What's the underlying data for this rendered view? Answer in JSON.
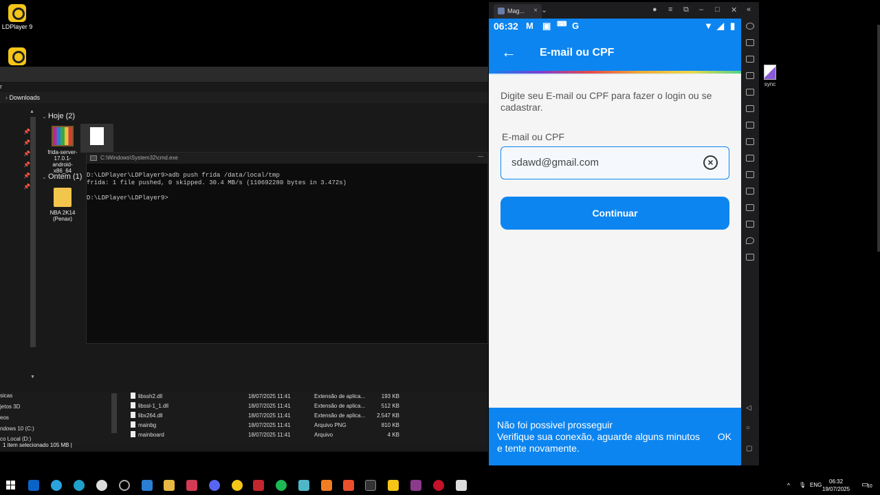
{
  "desktop": {
    "ldplayer_icon_label": "LDPlayer 9",
    "sync_label": "sync"
  },
  "explorer": {
    "breadcrumb": "Downloads",
    "groups": [
      {
        "label": "Hoje (2)"
      },
      {
        "label": "Ontem (1)"
      }
    ],
    "files": [
      {
        "name": "frida-server-17.0.1-android-x86_64",
        "icon": "winrar-icon"
      },
      {
        "name": "NBA 2K14 (Penax)",
        "icon": "folder-icon"
      }
    ],
    "nav_items": [
      "sicas",
      "jetos 3D",
      "eos",
      "ndows 10 (C:)",
      "co Local (D:)"
    ],
    "detail_rows": [
      {
        "name": "libssh2.dll",
        "date": "18/07/2025 11:41",
        "type": "Extensão de aplica...",
        "size": "193 KB"
      },
      {
        "name": "libssl-1_1.dll",
        "date": "18/07/2025 11:41",
        "type": "Extensão de aplica...",
        "size": "512 KB"
      },
      {
        "name": "libx264.dll",
        "date": "18/07/2025 11:41",
        "type": "Extensão de aplica...",
        "size": "2.547 KB"
      },
      {
        "name": "mainbg",
        "date": "18/07/2025 11:41",
        "type": "Arquivo PNG",
        "size": "810 KB"
      },
      {
        "name": "mainboard",
        "date": "18/07/2025 11:41",
        "type": "Arquivo",
        "size": "4 KB"
      }
    ],
    "status": "1 item selecionado  105 MB  |"
  },
  "cmd": {
    "title": "C:\\Windows\\System32\\cmd.exe",
    "lines": "D:\\LDPlayer\\LDPlayer9>adb push frida /data/local/tmp\nfrida: 1 file pushed, 0 skipped. 30.4 MB/s (110692280 bytes in 3.472s)\n\nD:\\LDPlayer\\LDPlayer9>"
  },
  "ldplayer": {
    "tab_label": "Mag...",
    "status_time": "06:32",
    "appbar_title": "E-mail ou CPF",
    "description": "Digite seu E-mail ou CPF para fazer o login ou se cadastrar.",
    "field_label": "E-mail ou CPF",
    "field_value": "sdawd@gmail.com",
    "continue_label": "Continuar",
    "snackbar_message": "Não foi possivel prosseguir\nVerifique sua conexão, aguarde alguns minutos e tente novamente.",
    "snackbar_action": "OK"
  },
  "taskbar": {
    "language": "ENG",
    "time": "06:32",
    "date": "19/07/2025",
    "notifications": "10"
  },
  "colors": {
    "accent": "#0d85f0",
    "snackbar": "#0d85f0"
  }
}
